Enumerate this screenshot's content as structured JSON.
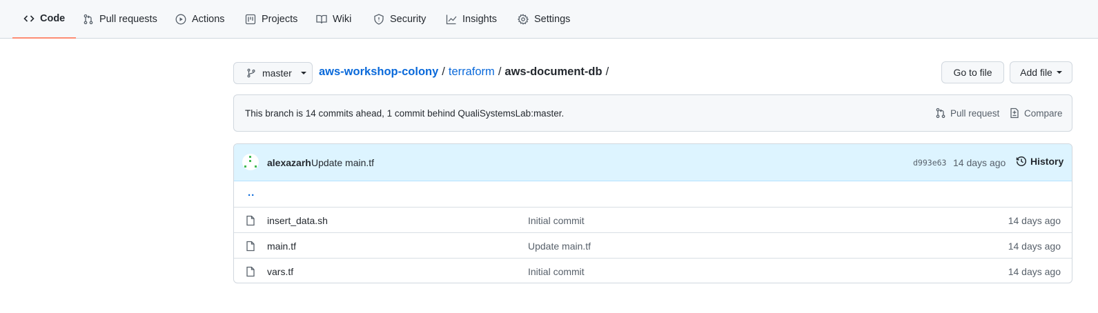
{
  "tabs": [
    {
      "label": "Code",
      "icon": "code-icon",
      "selected": true
    },
    {
      "label": "Pull requests",
      "icon": "git-pull-request-icon"
    },
    {
      "label": "Actions",
      "icon": "play-icon"
    },
    {
      "label": "Projects",
      "icon": "project-icon"
    },
    {
      "label": "Wiki",
      "icon": "book-icon"
    },
    {
      "label": "Security",
      "icon": "shield-icon"
    },
    {
      "label": "Insights",
      "icon": "graph-icon"
    },
    {
      "label": "Settings",
      "icon": "gear-icon"
    }
  ],
  "branch": {
    "name": "master"
  },
  "breadcrumb": {
    "repo": "aws-workshop-colony",
    "folder": "terraform",
    "current": "aws-document-db",
    "separator": "/"
  },
  "buttons": {
    "go_to_file": "Go to file",
    "add_file": "Add file"
  },
  "ahead_behind": {
    "message": "This branch is 14 commits ahead, 1 commit behind QualiSystemsLab:master.",
    "pull_request": "Pull request",
    "compare": "Compare"
  },
  "latest_commit": {
    "author": "alexazarh",
    "message": "Update main.tf",
    "sha": "d993e63",
    "age": "14 days ago",
    "history": "History"
  },
  "parent_dir": "..",
  "files": [
    {
      "name": "insert_data.sh",
      "message": "Initial commit",
      "age": "14 days ago",
      "icon": "file-icon"
    },
    {
      "name": "main.tf",
      "message": "Update main.tf",
      "age": "14 days ago",
      "icon": "file-icon"
    },
    {
      "name": "vars.tf",
      "message": "Initial commit",
      "age": "14 days ago",
      "icon": "file-icon"
    }
  ],
  "colors": {
    "accent": "#fd8c73",
    "link": "#0969da",
    "commit_bg": "#ddf4ff"
  }
}
